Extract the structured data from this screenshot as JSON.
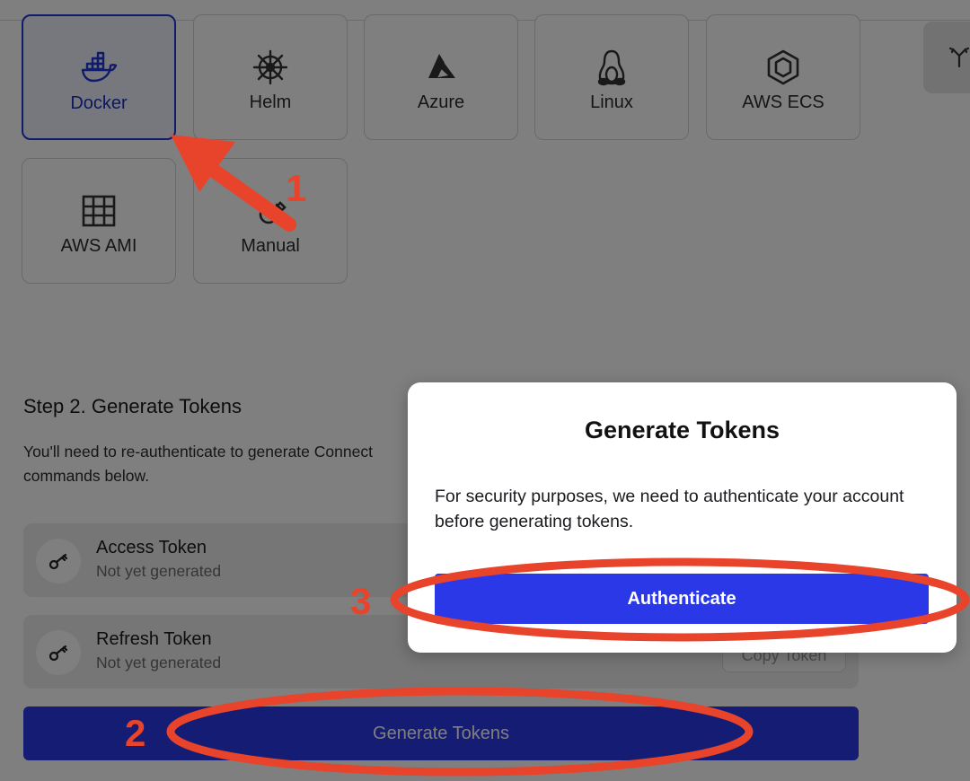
{
  "platforms": [
    {
      "label": "Docker",
      "icon": "docker-icon",
      "selected": true
    },
    {
      "label": "Helm",
      "icon": "helm-wheel-icon"
    },
    {
      "label": "Azure",
      "icon": "azure-icon"
    },
    {
      "label": "Linux",
      "icon": "linux-penguin-icon"
    },
    {
      "label": "AWS ECS",
      "icon": "aws-ecs-icon"
    },
    {
      "label": "AWS AMI",
      "icon": "aws-ami-grid-icon"
    },
    {
      "label": "Manual",
      "icon": "manual-icon"
    }
  ],
  "side_button": {
    "icon": "fork-icon"
  },
  "step2": {
    "title": "Step 2. Generate Tokens",
    "description": "You'll need to re-authenticate to generate Connect commands below."
  },
  "tokens": [
    {
      "name": "Access Token",
      "status": "Not yet generated",
      "icon": "key-icon"
    },
    {
      "name": "Refresh Token",
      "status": "Not yet generated",
      "icon": "key-icon",
      "copy_label": "Copy Token"
    }
  ],
  "generate_button": {
    "label": "Generate Tokens"
  },
  "modal": {
    "title": "Generate Tokens",
    "body": "For security purposes, we need to authenticate your account before generating tokens.",
    "button": "Authenticate"
  },
  "annotations": {
    "step1": "1",
    "step2": "2",
    "step3": "3",
    "color": "#e8432b"
  },
  "colors": {
    "accent": "#2b38e8",
    "selected_text": "#1d2fb8",
    "overlay": "rgba(0,0,0,0.5)"
  }
}
